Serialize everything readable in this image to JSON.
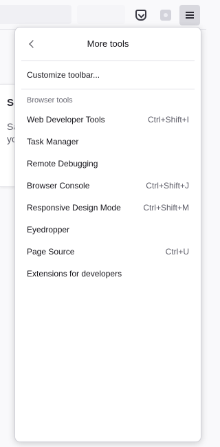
{
  "toolbar": {
    "pocket_icon": "pocket-icon",
    "extension_icon": "extension-icon",
    "menu_icon": "hamburger-menu-icon"
  },
  "background": {
    "heading": "Si",
    "line1": "Sa",
    "line2": "yo"
  },
  "panel": {
    "title": "More tools",
    "back_icon": "chevron-left-icon",
    "customize": "Customize toolbar...",
    "section_label": "Browser tools",
    "items": [
      {
        "label": "Web Developer Tools",
        "shortcut": "Ctrl+Shift+I"
      },
      {
        "label": "Task Manager",
        "shortcut": ""
      },
      {
        "label": "Remote Debugging",
        "shortcut": ""
      },
      {
        "label": "Browser Console",
        "shortcut": "Ctrl+Shift+J"
      },
      {
        "label": "Responsive Design Mode",
        "shortcut": "Ctrl+Shift+M"
      },
      {
        "label": "Eyedropper",
        "shortcut": ""
      },
      {
        "label": "Page Source",
        "shortcut": "Ctrl+U"
      },
      {
        "label": "Extensions for developers",
        "shortcut": ""
      }
    ]
  }
}
